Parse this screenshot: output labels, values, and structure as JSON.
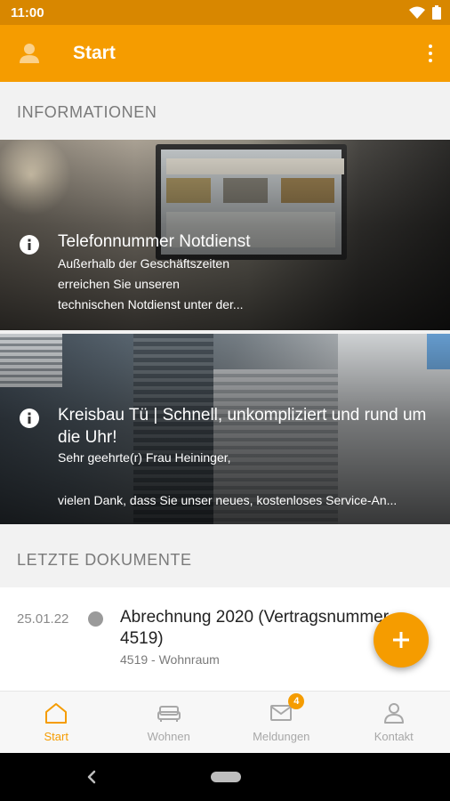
{
  "status_bar": {
    "time": "11:00"
  },
  "app_bar": {
    "title": "Start"
  },
  "sections": {
    "informationen": "INFORMATIONEN",
    "letzte_dokumente": "LETZTE DOKUMENTE"
  },
  "info_cards": [
    {
      "title": "Telefonnummer Notdienst",
      "lines": [
        "Außerhalb der Geschäftszeiten",
        "erreichen Sie unseren",
        "technischen Notdienst unter der..."
      ]
    },
    {
      "title": "Kreisbau Tü | Schnell, unkompliziert und rund um die Uhr!",
      "lines": [
        "Sehr geehrte(r) Frau Heininger,",
        "vielen Dank, dass Sie unser neues, kostenloses Service-An..."
      ]
    }
  ],
  "documents": [
    {
      "date": "25.01.22",
      "title": "Abrechnung 2020 (Vertragsnummer 4519)",
      "subtitle": "4519 - Wohnraum"
    }
  ],
  "bottom_nav": {
    "items": [
      {
        "label": "Start",
        "icon": "home-icon",
        "active": true
      },
      {
        "label": "Wohnen",
        "icon": "sofa-icon",
        "active": false
      },
      {
        "label": "Meldungen",
        "icon": "mail-icon",
        "active": false,
        "badge": "4"
      },
      {
        "label": "Kontakt",
        "icon": "person-icon",
        "active": false
      }
    ]
  },
  "colors": {
    "primary": "#f59c00",
    "status_bar": "#d88700",
    "inactive": "#a8a8a8"
  }
}
